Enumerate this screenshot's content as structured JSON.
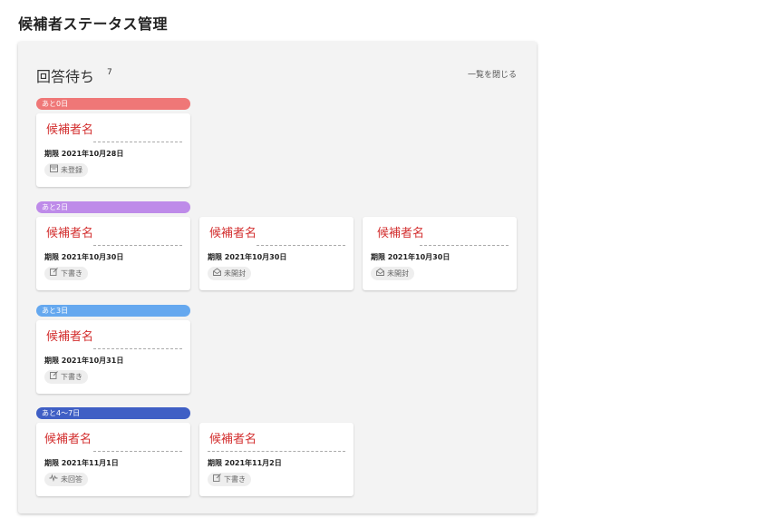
{
  "page": {
    "title": "候補者ステータス管理"
  },
  "panel": {
    "title": "回答待ち",
    "count": "7",
    "close_label": "一覧を閉じる"
  },
  "groups": [
    {
      "label": "あと0日",
      "color": "#ef7777",
      "cards": [
        {
          "name": "候補者名",
          "deadline": "期限 2021年10月28日",
          "status": "未登録",
          "status_icon": "calendar-icon"
        }
      ]
    },
    {
      "label": "あと2日",
      "color": "#be8be9",
      "cards": [
        {
          "name": "候補者名",
          "deadline": "期限 2021年10月30日",
          "status": "下書き",
          "status_icon": "draft-icon"
        },
        {
          "name": "候補者名",
          "deadline": "期限 2021年10月30日",
          "status": "未開封",
          "status_icon": "mail-icon"
        },
        {
          "name": "候補者名",
          "deadline": "期限 2021年10月30日",
          "status": "未開封",
          "status_icon": "mail-icon"
        }
      ]
    },
    {
      "label": "あと3日",
      "color": "#65a8ef",
      "cards": [
        {
          "name": "候補者名",
          "deadline": "期限 2021年10月31日",
          "status": "下書き",
          "status_icon": "draft-icon"
        }
      ]
    },
    {
      "label": "あと4〜7日",
      "color": "#3f5fc5",
      "cards": [
        {
          "name": "候補者名",
          "deadline": "期限 2021年11月1日",
          "status": "未回答",
          "status_icon": "activity-icon"
        },
        {
          "name": "候補者名",
          "deadline": "期限 2021年11月2日",
          "status": "下書き",
          "status_icon": "draft-icon"
        }
      ]
    }
  ]
}
